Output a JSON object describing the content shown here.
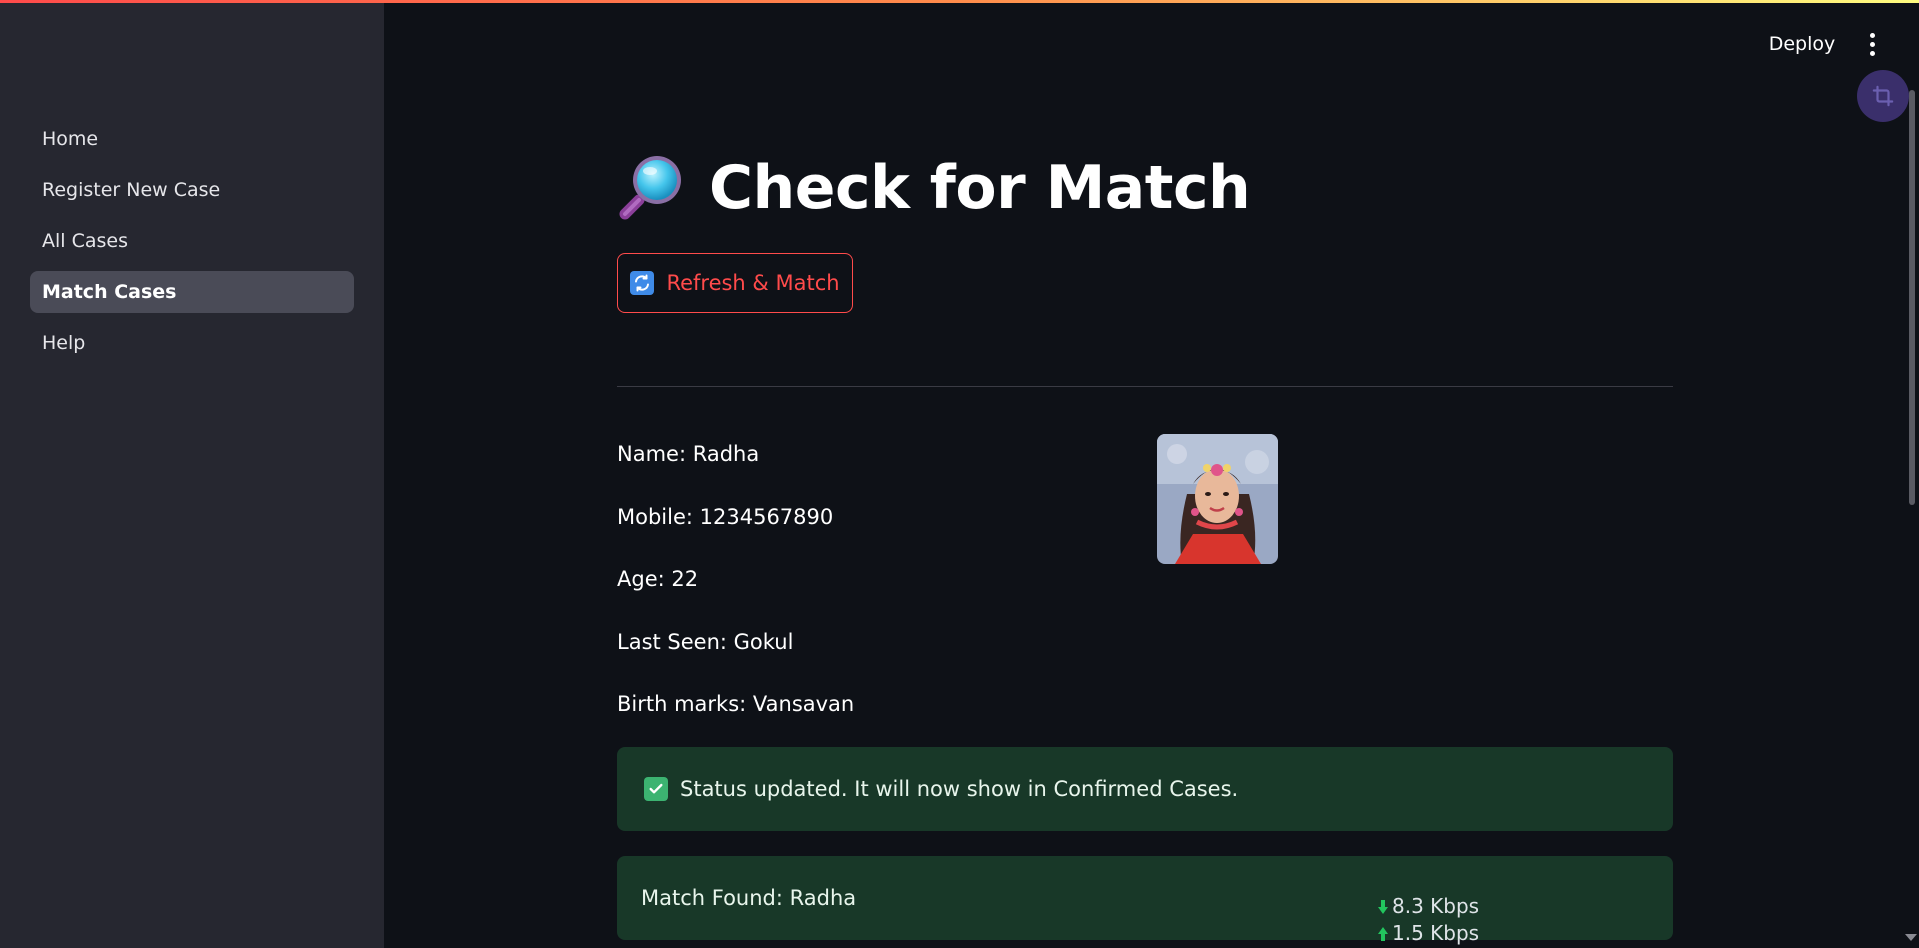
{
  "sidebar": {
    "items": [
      {
        "label": "Home"
      },
      {
        "label": "Register New Case"
      },
      {
        "label": "All Cases"
      },
      {
        "label": "Match Cases",
        "active": true
      },
      {
        "label": "Help"
      }
    ]
  },
  "header": {
    "deploy_label": "Deploy"
  },
  "main": {
    "title": "Check for Match",
    "refresh_label": "Refresh & Match",
    "person": {
      "name": "Name: Radha",
      "mobile": "Mobile: 1234567890",
      "age": "Age: 22",
      "last_seen": "Last Seen: Gokul",
      "birth_marks": "Birth marks: Vansavan"
    },
    "status_message": "Status updated. It will now show in Confirmed Cases.",
    "match_message": "Match Found: Radha"
  },
  "network": {
    "download": "8.3 Kbps",
    "upload": "1.5 Kbps"
  },
  "colors": {
    "accent": "#ff4b4b",
    "sidebar_bg": "#262730",
    "main_bg": "#0e1117",
    "success_bg": "#183828"
  }
}
